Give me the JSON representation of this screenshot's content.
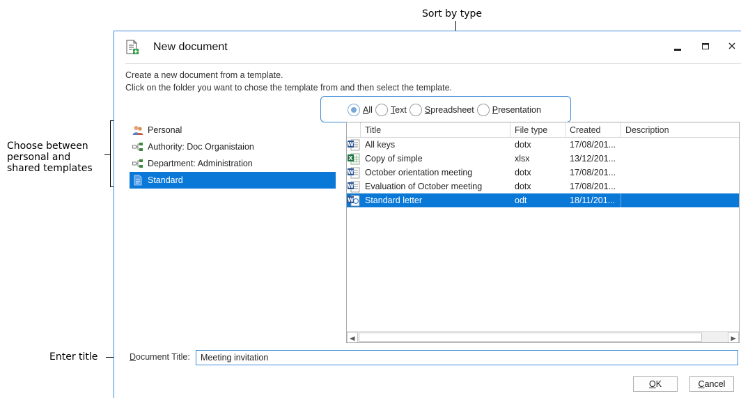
{
  "callouts": {
    "sort_by_type": "Sort by type",
    "choose_between_line1": "Choose between",
    "choose_between_line2": "personal and",
    "choose_between_line3": "shared templates",
    "enter_title": "Enter title"
  },
  "dialog": {
    "title": "New document",
    "instruction_line1": "Create a new document from a template.",
    "instruction_line2": "Click on the folder you want to chose the template from and then select the template."
  },
  "filter": {
    "options": [
      {
        "label": "All",
        "mnemonic": "A",
        "rest": "ll",
        "checked": true
      },
      {
        "label": "Text",
        "mnemonic": "T",
        "rest": "ext",
        "checked": false
      },
      {
        "label": "Spreadsheet",
        "mnemonic": "S",
        "rest": "preadsheet",
        "checked": false
      },
      {
        "label": "Presentation",
        "mnemonic": "P",
        "rest": "resentation",
        "checked": false
      }
    ]
  },
  "tree": {
    "items": [
      {
        "label": "Personal",
        "icon": "personal-users-icon"
      },
      {
        "label": "Authority: Doc Organistaion",
        "icon": "org-structure-icon"
      },
      {
        "label": "Department: Administration",
        "icon": "org-structure-icon"
      },
      {
        "label": "Standard",
        "icon": "document-icon",
        "selected": true
      }
    ]
  },
  "table": {
    "columns": [
      "Title",
      "File type",
      "Created",
      "Description"
    ],
    "rows": [
      {
        "icon": "word-icon",
        "title": "All keys",
        "type": "dotx",
        "created": "17/08/201...",
        "description": ""
      },
      {
        "icon": "excel-icon",
        "title": "Copy of simple",
        "type": "xlsx",
        "created": "13/12/201...",
        "description": ""
      },
      {
        "icon": "word-icon",
        "title": "October orientation meeting",
        "type": "dotx",
        "created": "17/08/201...",
        "description": ""
      },
      {
        "icon": "word-icon",
        "title": "Evaluation of October meeting",
        "type": "dotx",
        "created": "17/08/201...",
        "description": ""
      },
      {
        "icon": "word-odt-icon",
        "title": "Standard letter",
        "type": "odt",
        "created": "18/11/201...",
        "description": "",
        "selected": true
      }
    ]
  },
  "footer": {
    "doc_title_mnemonic": "D",
    "doc_title_rest": "ocument Title:",
    "doc_title_value": "Meeting invitation",
    "ok_mnemonic": "O",
    "ok_rest": "K",
    "cancel_mnemonic": "C",
    "cancel_rest": "ancel"
  },
  "colors": {
    "accent": "#0a78d7",
    "border_blue": "#3b8ad6",
    "word_blue": "#2b5797",
    "excel_green": "#1e7145"
  }
}
